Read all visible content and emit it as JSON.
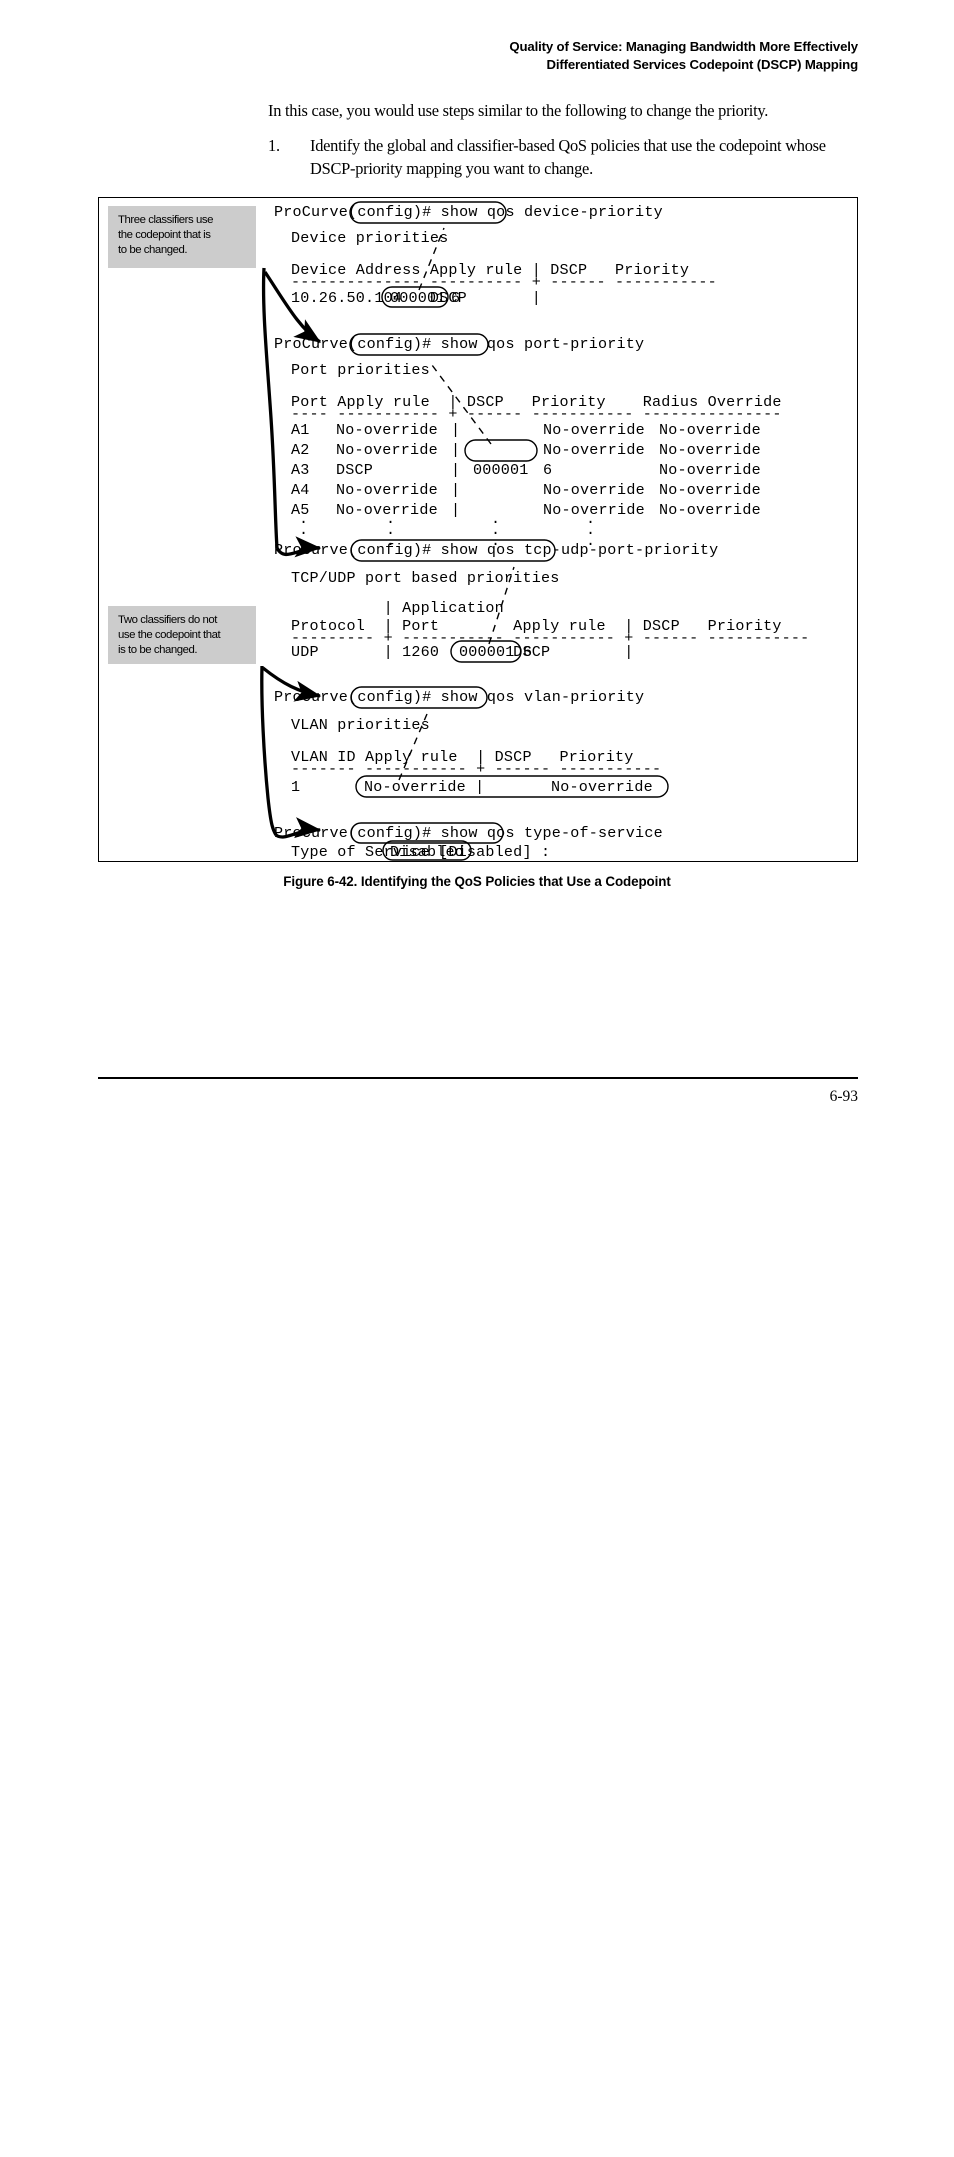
{
  "header": {
    "line1": "Quality of Service: Managing Bandwidth More Effectively",
    "line2": "Differentiated Services Codepoint (DSCP) Mapping"
  },
  "intro": {
    "paragraph": "In this case, you would use steps similar to the following to change the priority."
  },
  "steps": [
    {
      "number": "1.",
      "text": "Identify the global and classifier-based QoS policies that use the codepoint whose DSCP-priority mapping you want to change."
    }
  ],
  "callouts": {
    "three_classifiers": {
      "line1": "Three classifiers use",
      "line2": "the codepoint that is",
      "line3": "to be changed."
    },
    "two_classifiers": {
      "line1": "Two classifiers do not",
      "line2": "use the codepoint that",
      "line3": "is to be changed."
    }
  },
  "terminal": {
    "device_priority": {
      "prompt": "ProCurve(config)# show qos ",
      "command": "device-priority",
      "heading": "Device priorities",
      "col_header": "Device Address Apply rule | DSCP   Priority",
      "separator": "-------------- ---------- + ------ -----------",
      "row_prefix": "10.26.50.104   DSCP       |",
      "row_dscp": "000001",
      "row_priority": "6"
    },
    "port_priority": {
      "prompt": "ProCurve(config)# show qos ",
      "command": "port-priority",
      "heading": "Port priorities",
      "col_header": "Port Apply rule  | DSCP   Priority    Radius Override",
      "separator": "---- ----------- + ------ ----------- ---------------",
      "rows": [
        {
          "port": "A1",
          "rule": "No-override",
          "bar": "|",
          "dscp": "",
          "priority": "No-override",
          "radius": "No-override"
        },
        {
          "port": "A2",
          "rule": "No-override",
          "bar": "|",
          "dscp": "",
          "priority": "No-override",
          "radius": "No-override"
        },
        {
          "port": "A3",
          "rule": "DSCP",
          "bar": "|",
          "dscp": "000001",
          "priority": "6",
          "radius": "No-override"
        },
        {
          "port": "A4",
          "rule": "No-override",
          "bar": "|",
          "dscp": "",
          "priority": "No-override",
          "radius": "No-override"
        },
        {
          "port": "A5",
          "rule": "No-override",
          "bar": "|",
          "dscp": "",
          "priority": "No-override",
          "radius": "No-override"
        }
      ],
      "ellipsis": "."
    },
    "tcp_udp_port_priority": {
      "prompt": "ProCurve(config)# show qos ",
      "command": "tcp-udp-port-priority",
      "heading": "TCP/UDP port based priorities",
      "col_header_top": "          | Application",
      "col_header": "Protocol  | Port        Apply rule  | DSCP   Priority",
      "separator": "--------- + ----------- ----------- + ------ -----------",
      "row_prefix": "UDP       | 1260        DSCP        |",
      "row_dscp": "000001",
      "row_priority": "6"
    },
    "vlan_priority": {
      "prompt": "ProCurve(config)# show qos ",
      "command": "vlan-priority",
      "heading": "VLAN priorities",
      "col_header": "VLAN ID Apply rule  | DSCP   Priority",
      "separator": "------- ----------- + ------ -----------",
      "row_id": "1",
      "row_rule": "No-override |",
      "row_priority": "No-override"
    },
    "type_of_service": {
      "prompt": "ProCurve(config)# show qos ",
      "command": "type-of-service",
      "result_prefix": "Type of Service [Disabled] :",
      "result_value": "Disabled"
    }
  },
  "figure": {
    "caption": "Figure 6-42.  Identifying the QoS Policies that Use a Codepoint"
  },
  "footer": {
    "page_number": "6-93"
  }
}
